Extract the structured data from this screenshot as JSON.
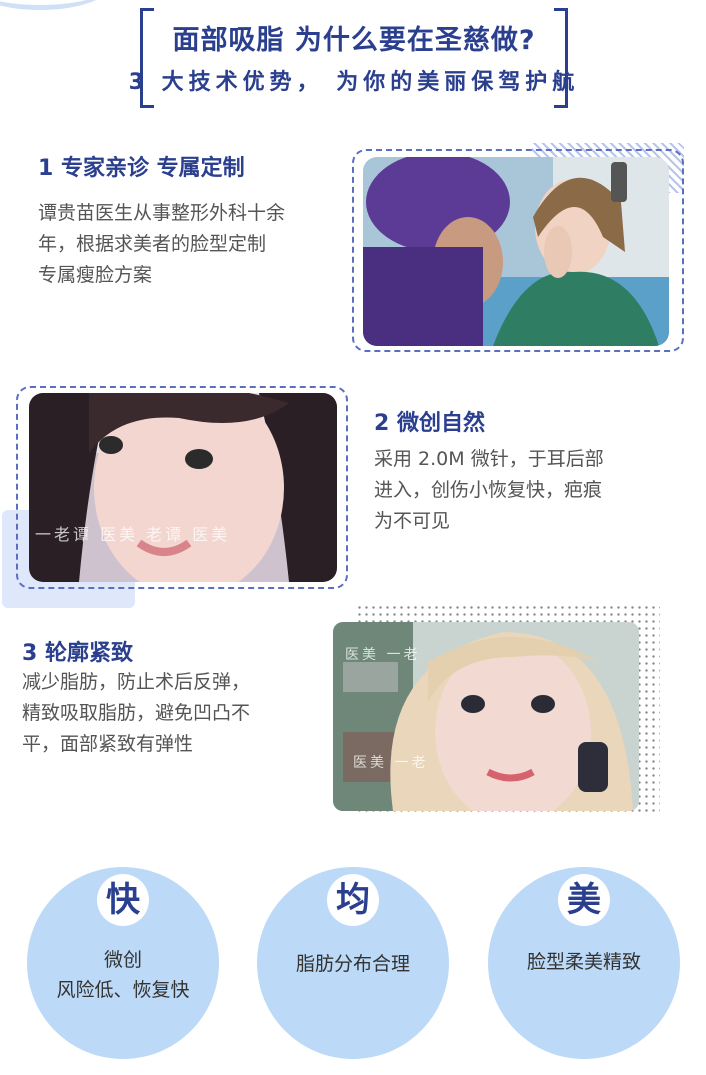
{
  "header": {
    "title": "面部吸脂 为什么要在圣慈做?",
    "subtitle": "3 大技术优势， 为你的美丽保驾护航"
  },
  "sections": [
    {
      "title": "1 专家亲诊 专属定制",
      "desc": [
        "谭贵苗医生从事整形外科十余",
        "年，根据求美者的脸型定制",
        "专属瘦脸方案"
      ]
    },
    {
      "title": "2 微创自然",
      "desc": [
        "采用 2.0M 微针，于耳后部",
        "进入，创伤小恢复快，疤痕",
        "为不可见"
      ],
      "watermark": "一老谭   医美   老谭   医美"
    },
    {
      "title": "3 轮廓紧致",
      "desc": [
        "减少脂肪，防止术后反弹，",
        "精致吸取脂肪，避免凹凸不",
        "平，面部紧致有弹性"
      ],
      "watermark_top": "医美 一老",
      "watermark_bottom": "医美   一老"
    }
  ],
  "features": [
    {
      "char": "快",
      "lines": [
        "微创",
        "风险低、恢复快"
      ]
    },
    {
      "char": "均",
      "lines": [
        "脂肪分布合理"
      ]
    },
    {
      "char": "美",
      "lines": [
        "脸型柔美精致"
      ]
    }
  ],
  "colors": {
    "accent": "#2b3f8f",
    "circle": "#bcd9f7",
    "frame": "#5a6fc0"
  }
}
